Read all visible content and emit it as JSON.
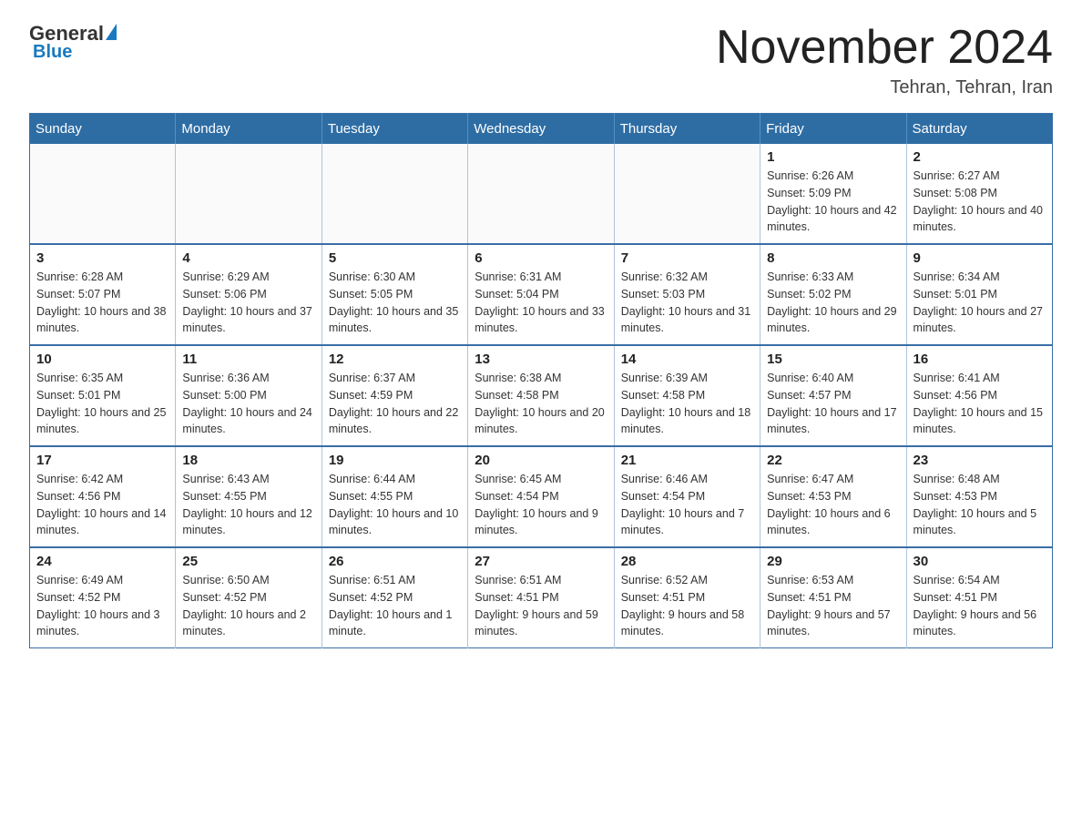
{
  "header": {
    "logo": {
      "part1": "General",
      "part2": "Blue"
    },
    "title": "November 2024",
    "subtitle": "Tehran, Tehran, Iran"
  },
  "weekdays": [
    "Sunday",
    "Monday",
    "Tuesday",
    "Wednesday",
    "Thursday",
    "Friday",
    "Saturday"
  ],
  "weeks": [
    [
      {
        "day": "",
        "info": ""
      },
      {
        "day": "",
        "info": ""
      },
      {
        "day": "",
        "info": ""
      },
      {
        "day": "",
        "info": ""
      },
      {
        "day": "",
        "info": ""
      },
      {
        "day": "1",
        "info": "Sunrise: 6:26 AM\nSunset: 5:09 PM\nDaylight: 10 hours and 42 minutes."
      },
      {
        "day": "2",
        "info": "Sunrise: 6:27 AM\nSunset: 5:08 PM\nDaylight: 10 hours and 40 minutes."
      }
    ],
    [
      {
        "day": "3",
        "info": "Sunrise: 6:28 AM\nSunset: 5:07 PM\nDaylight: 10 hours and 38 minutes."
      },
      {
        "day": "4",
        "info": "Sunrise: 6:29 AM\nSunset: 5:06 PM\nDaylight: 10 hours and 37 minutes."
      },
      {
        "day": "5",
        "info": "Sunrise: 6:30 AM\nSunset: 5:05 PM\nDaylight: 10 hours and 35 minutes."
      },
      {
        "day": "6",
        "info": "Sunrise: 6:31 AM\nSunset: 5:04 PM\nDaylight: 10 hours and 33 minutes."
      },
      {
        "day": "7",
        "info": "Sunrise: 6:32 AM\nSunset: 5:03 PM\nDaylight: 10 hours and 31 minutes."
      },
      {
        "day": "8",
        "info": "Sunrise: 6:33 AM\nSunset: 5:02 PM\nDaylight: 10 hours and 29 minutes."
      },
      {
        "day": "9",
        "info": "Sunrise: 6:34 AM\nSunset: 5:01 PM\nDaylight: 10 hours and 27 minutes."
      }
    ],
    [
      {
        "day": "10",
        "info": "Sunrise: 6:35 AM\nSunset: 5:01 PM\nDaylight: 10 hours and 25 minutes."
      },
      {
        "day": "11",
        "info": "Sunrise: 6:36 AM\nSunset: 5:00 PM\nDaylight: 10 hours and 24 minutes."
      },
      {
        "day": "12",
        "info": "Sunrise: 6:37 AM\nSunset: 4:59 PM\nDaylight: 10 hours and 22 minutes."
      },
      {
        "day": "13",
        "info": "Sunrise: 6:38 AM\nSunset: 4:58 PM\nDaylight: 10 hours and 20 minutes."
      },
      {
        "day": "14",
        "info": "Sunrise: 6:39 AM\nSunset: 4:58 PM\nDaylight: 10 hours and 18 minutes."
      },
      {
        "day": "15",
        "info": "Sunrise: 6:40 AM\nSunset: 4:57 PM\nDaylight: 10 hours and 17 minutes."
      },
      {
        "day": "16",
        "info": "Sunrise: 6:41 AM\nSunset: 4:56 PM\nDaylight: 10 hours and 15 minutes."
      }
    ],
    [
      {
        "day": "17",
        "info": "Sunrise: 6:42 AM\nSunset: 4:56 PM\nDaylight: 10 hours and 14 minutes."
      },
      {
        "day": "18",
        "info": "Sunrise: 6:43 AM\nSunset: 4:55 PM\nDaylight: 10 hours and 12 minutes."
      },
      {
        "day": "19",
        "info": "Sunrise: 6:44 AM\nSunset: 4:55 PM\nDaylight: 10 hours and 10 minutes."
      },
      {
        "day": "20",
        "info": "Sunrise: 6:45 AM\nSunset: 4:54 PM\nDaylight: 10 hours and 9 minutes."
      },
      {
        "day": "21",
        "info": "Sunrise: 6:46 AM\nSunset: 4:54 PM\nDaylight: 10 hours and 7 minutes."
      },
      {
        "day": "22",
        "info": "Sunrise: 6:47 AM\nSunset: 4:53 PM\nDaylight: 10 hours and 6 minutes."
      },
      {
        "day": "23",
        "info": "Sunrise: 6:48 AM\nSunset: 4:53 PM\nDaylight: 10 hours and 5 minutes."
      }
    ],
    [
      {
        "day": "24",
        "info": "Sunrise: 6:49 AM\nSunset: 4:52 PM\nDaylight: 10 hours and 3 minutes."
      },
      {
        "day": "25",
        "info": "Sunrise: 6:50 AM\nSunset: 4:52 PM\nDaylight: 10 hours and 2 minutes."
      },
      {
        "day": "26",
        "info": "Sunrise: 6:51 AM\nSunset: 4:52 PM\nDaylight: 10 hours and 1 minute."
      },
      {
        "day": "27",
        "info": "Sunrise: 6:51 AM\nSunset: 4:51 PM\nDaylight: 9 hours and 59 minutes."
      },
      {
        "day": "28",
        "info": "Sunrise: 6:52 AM\nSunset: 4:51 PM\nDaylight: 9 hours and 58 minutes."
      },
      {
        "day": "29",
        "info": "Sunrise: 6:53 AM\nSunset: 4:51 PM\nDaylight: 9 hours and 57 minutes."
      },
      {
        "day": "30",
        "info": "Sunrise: 6:54 AM\nSunset: 4:51 PM\nDaylight: 9 hours and 56 minutes."
      }
    ]
  ]
}
